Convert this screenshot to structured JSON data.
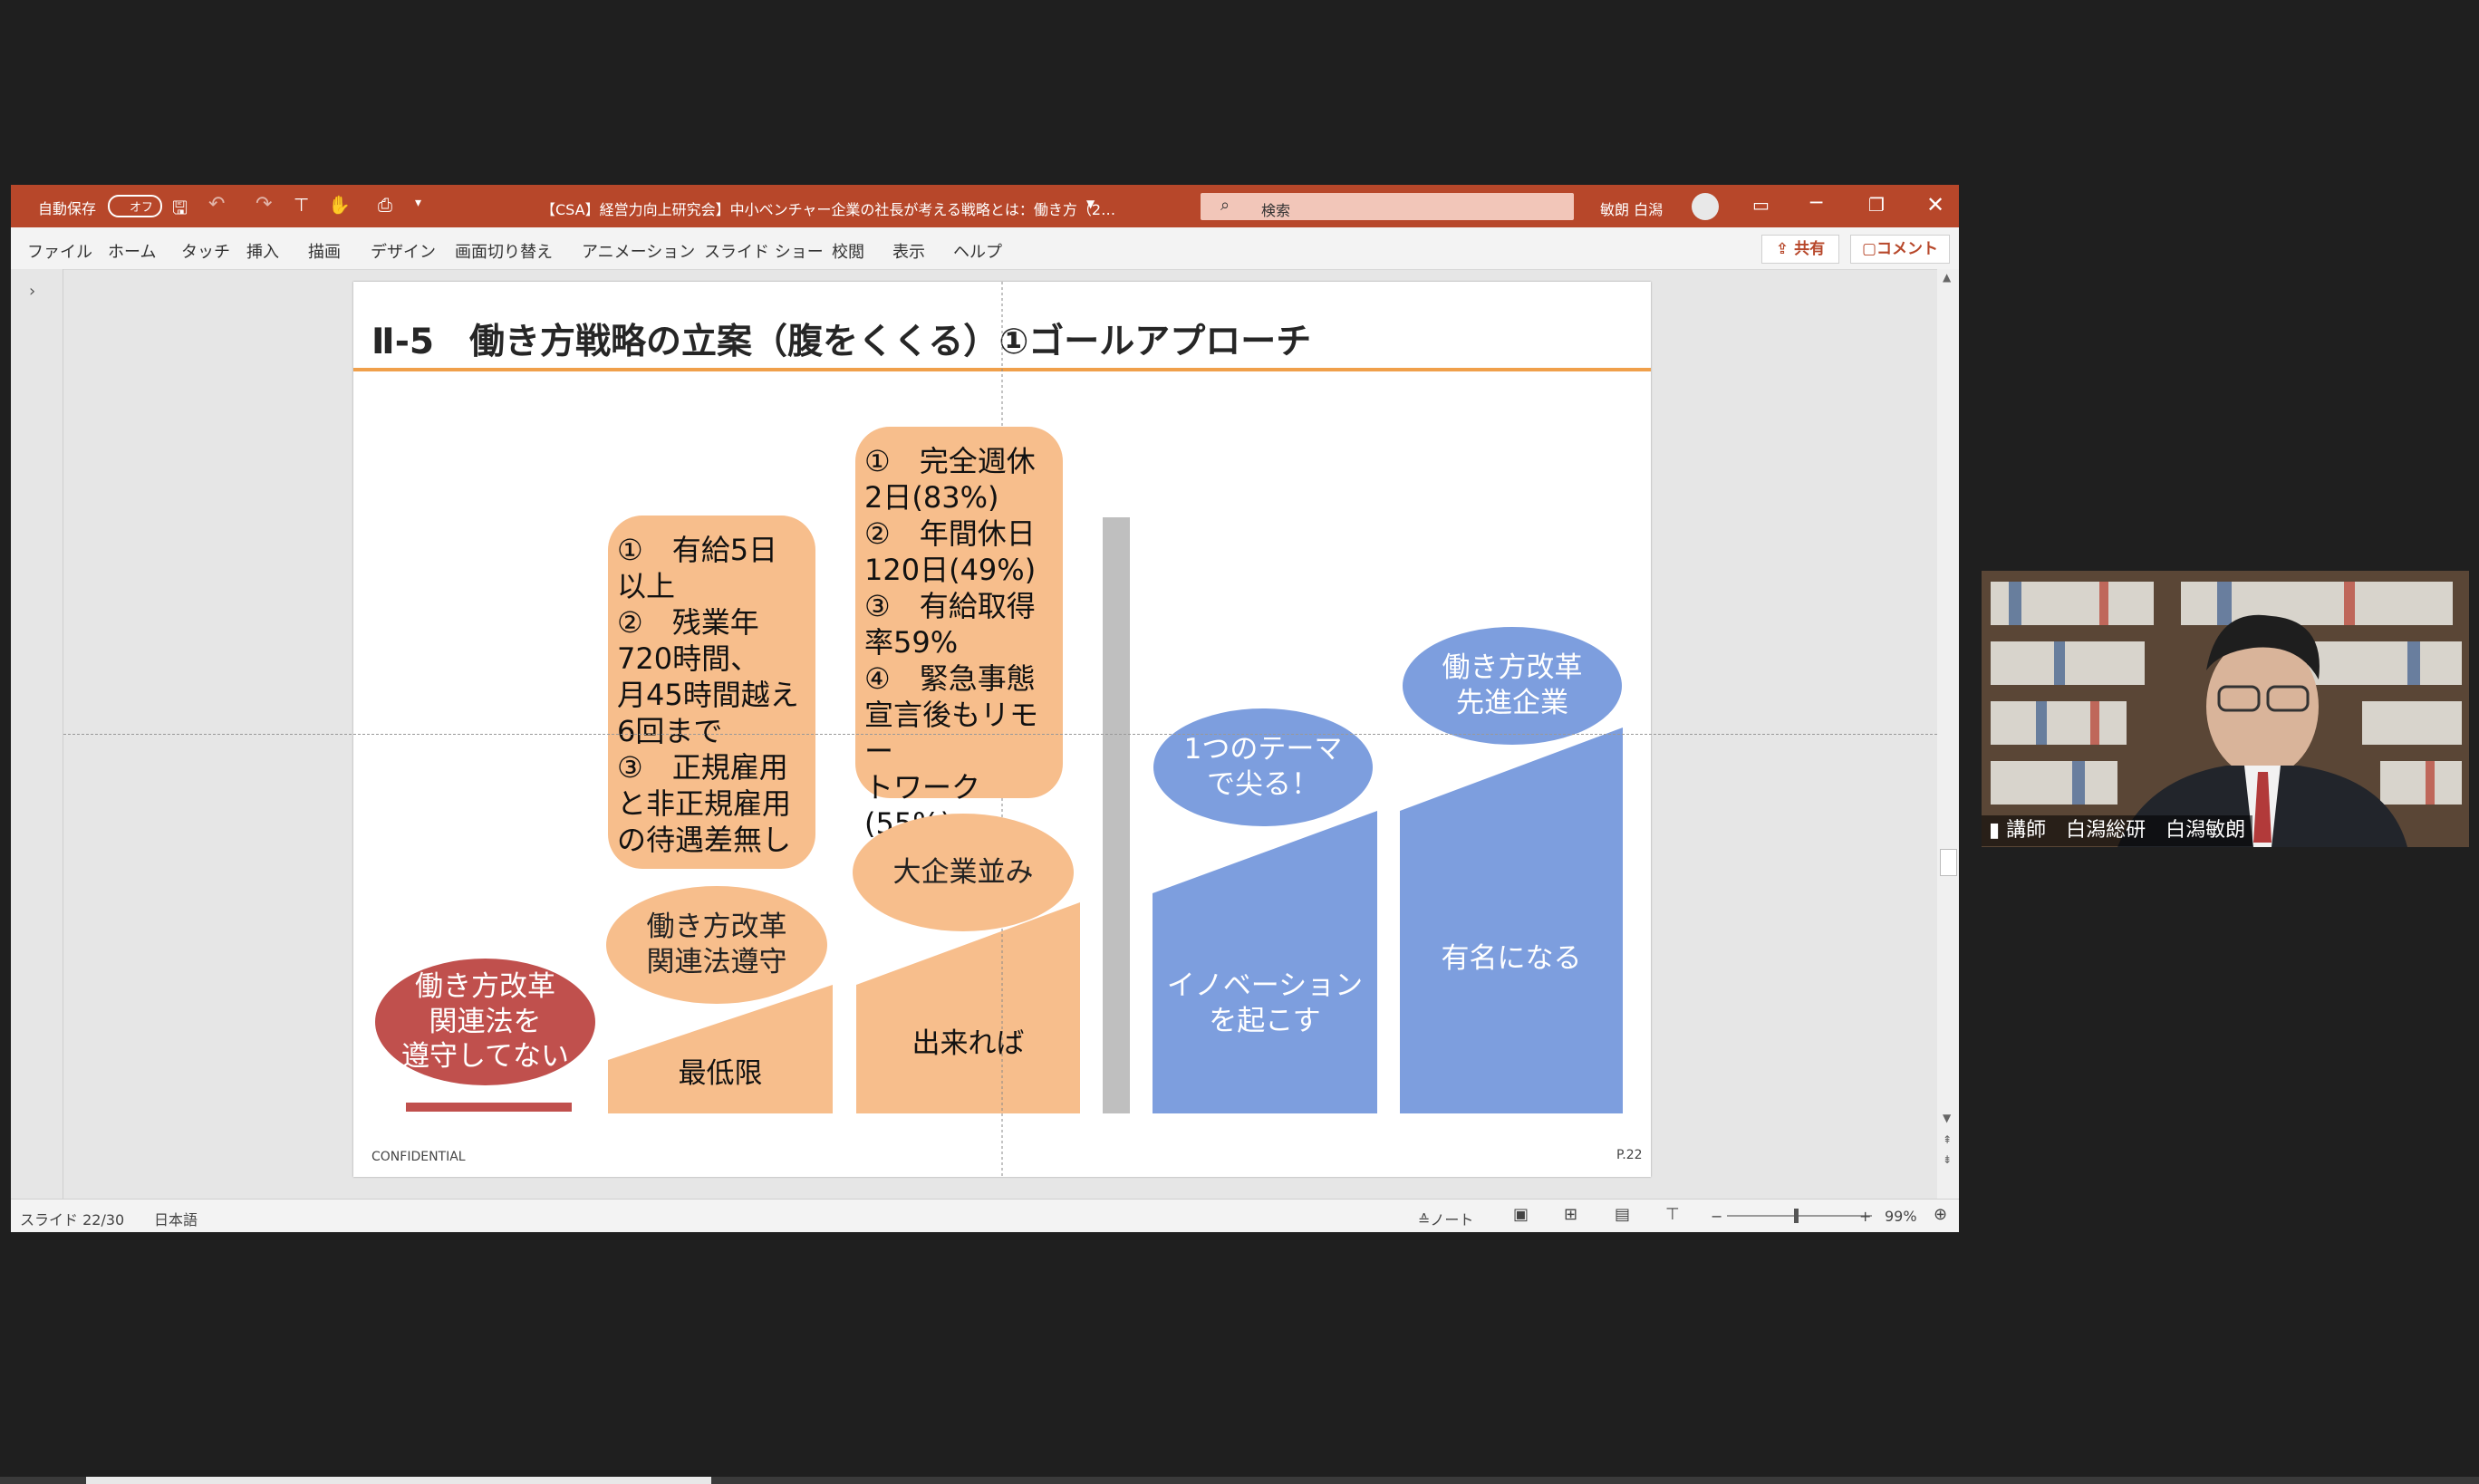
{
  "titlebar": {
    "autosave_label": "自動保存",
    "autosave_toggle": "オフ",
    "doc_title": "【CSA】経営力向上研究会】中小ベンチャー企業の社長が考える戦略とは：働き方（2…",
    "search_placeholder": "検索",
    "user_name": "敏朗 白潟"
  },
  "menu": {
    "items": [
      "ファイル",
      "ホーム",
      "タッチ",
      "挿入",
      "描画",
      "デザイン",
      "画面切り替え",
      "アニメーション",
      "スライド ショー",
      "校閲",
      "表示",
      "ヘルプ"
    ],
    "share_label": "共有",
    "comment_label": "コメント"
  },
  "slide": {
    "title": "Ⅱ-5　働き方戦略の立案（腹をくくる）①ゴールアプローチ",
    "footer_left": "CONFIDENTIAL",
    "footer_right": "P.22",
    "red_oval": "働き方改革\n関連法を\n遵守してない",
    "oval_law": "働き方改革\n関連法遵守",
    "box1": "①　有給5日\n以上\n②　残業年\n720時間、\n月45時間越え\n6回まで\n③　正規雇用\nと非正規雇用\nの待遇差無し",
    "box2": "①　完全週休\n2日(83%)\n②　年間休日\n120日(49%)\n③　有給取得\n率59%\n④　緊急事態\n宣言後もリモー\nトワーク(55%)",
    "oval_large": "大企業並み",
    "oval_theme": "1つのテーマ\nで尖る！",
    "oval_advanced": "働き方改革\n先進企業",
    "bar_min": "最低限",
    "bar_possible": "出来れば",
    "bar_innovation": "イノベーション\nを起こす",
    "bar_famous": "有名になる",
    "colors": {
      "peach": "#f7be8c",
      "blue": "#7d9ede",
      "red": "#c0504d",
      "gray": "#bfbfbf",
      "accent_line": "#f0a04b"
    }
  },
  "status": {
    "slide_num": "スライド 22/30",
    "language": "日本語",
    "notes": "ノート",
    "zoom": "99%"
  },
  "webcam": {
    "caption": "講師　白潟総研　白潟敏朗"
  }
}
